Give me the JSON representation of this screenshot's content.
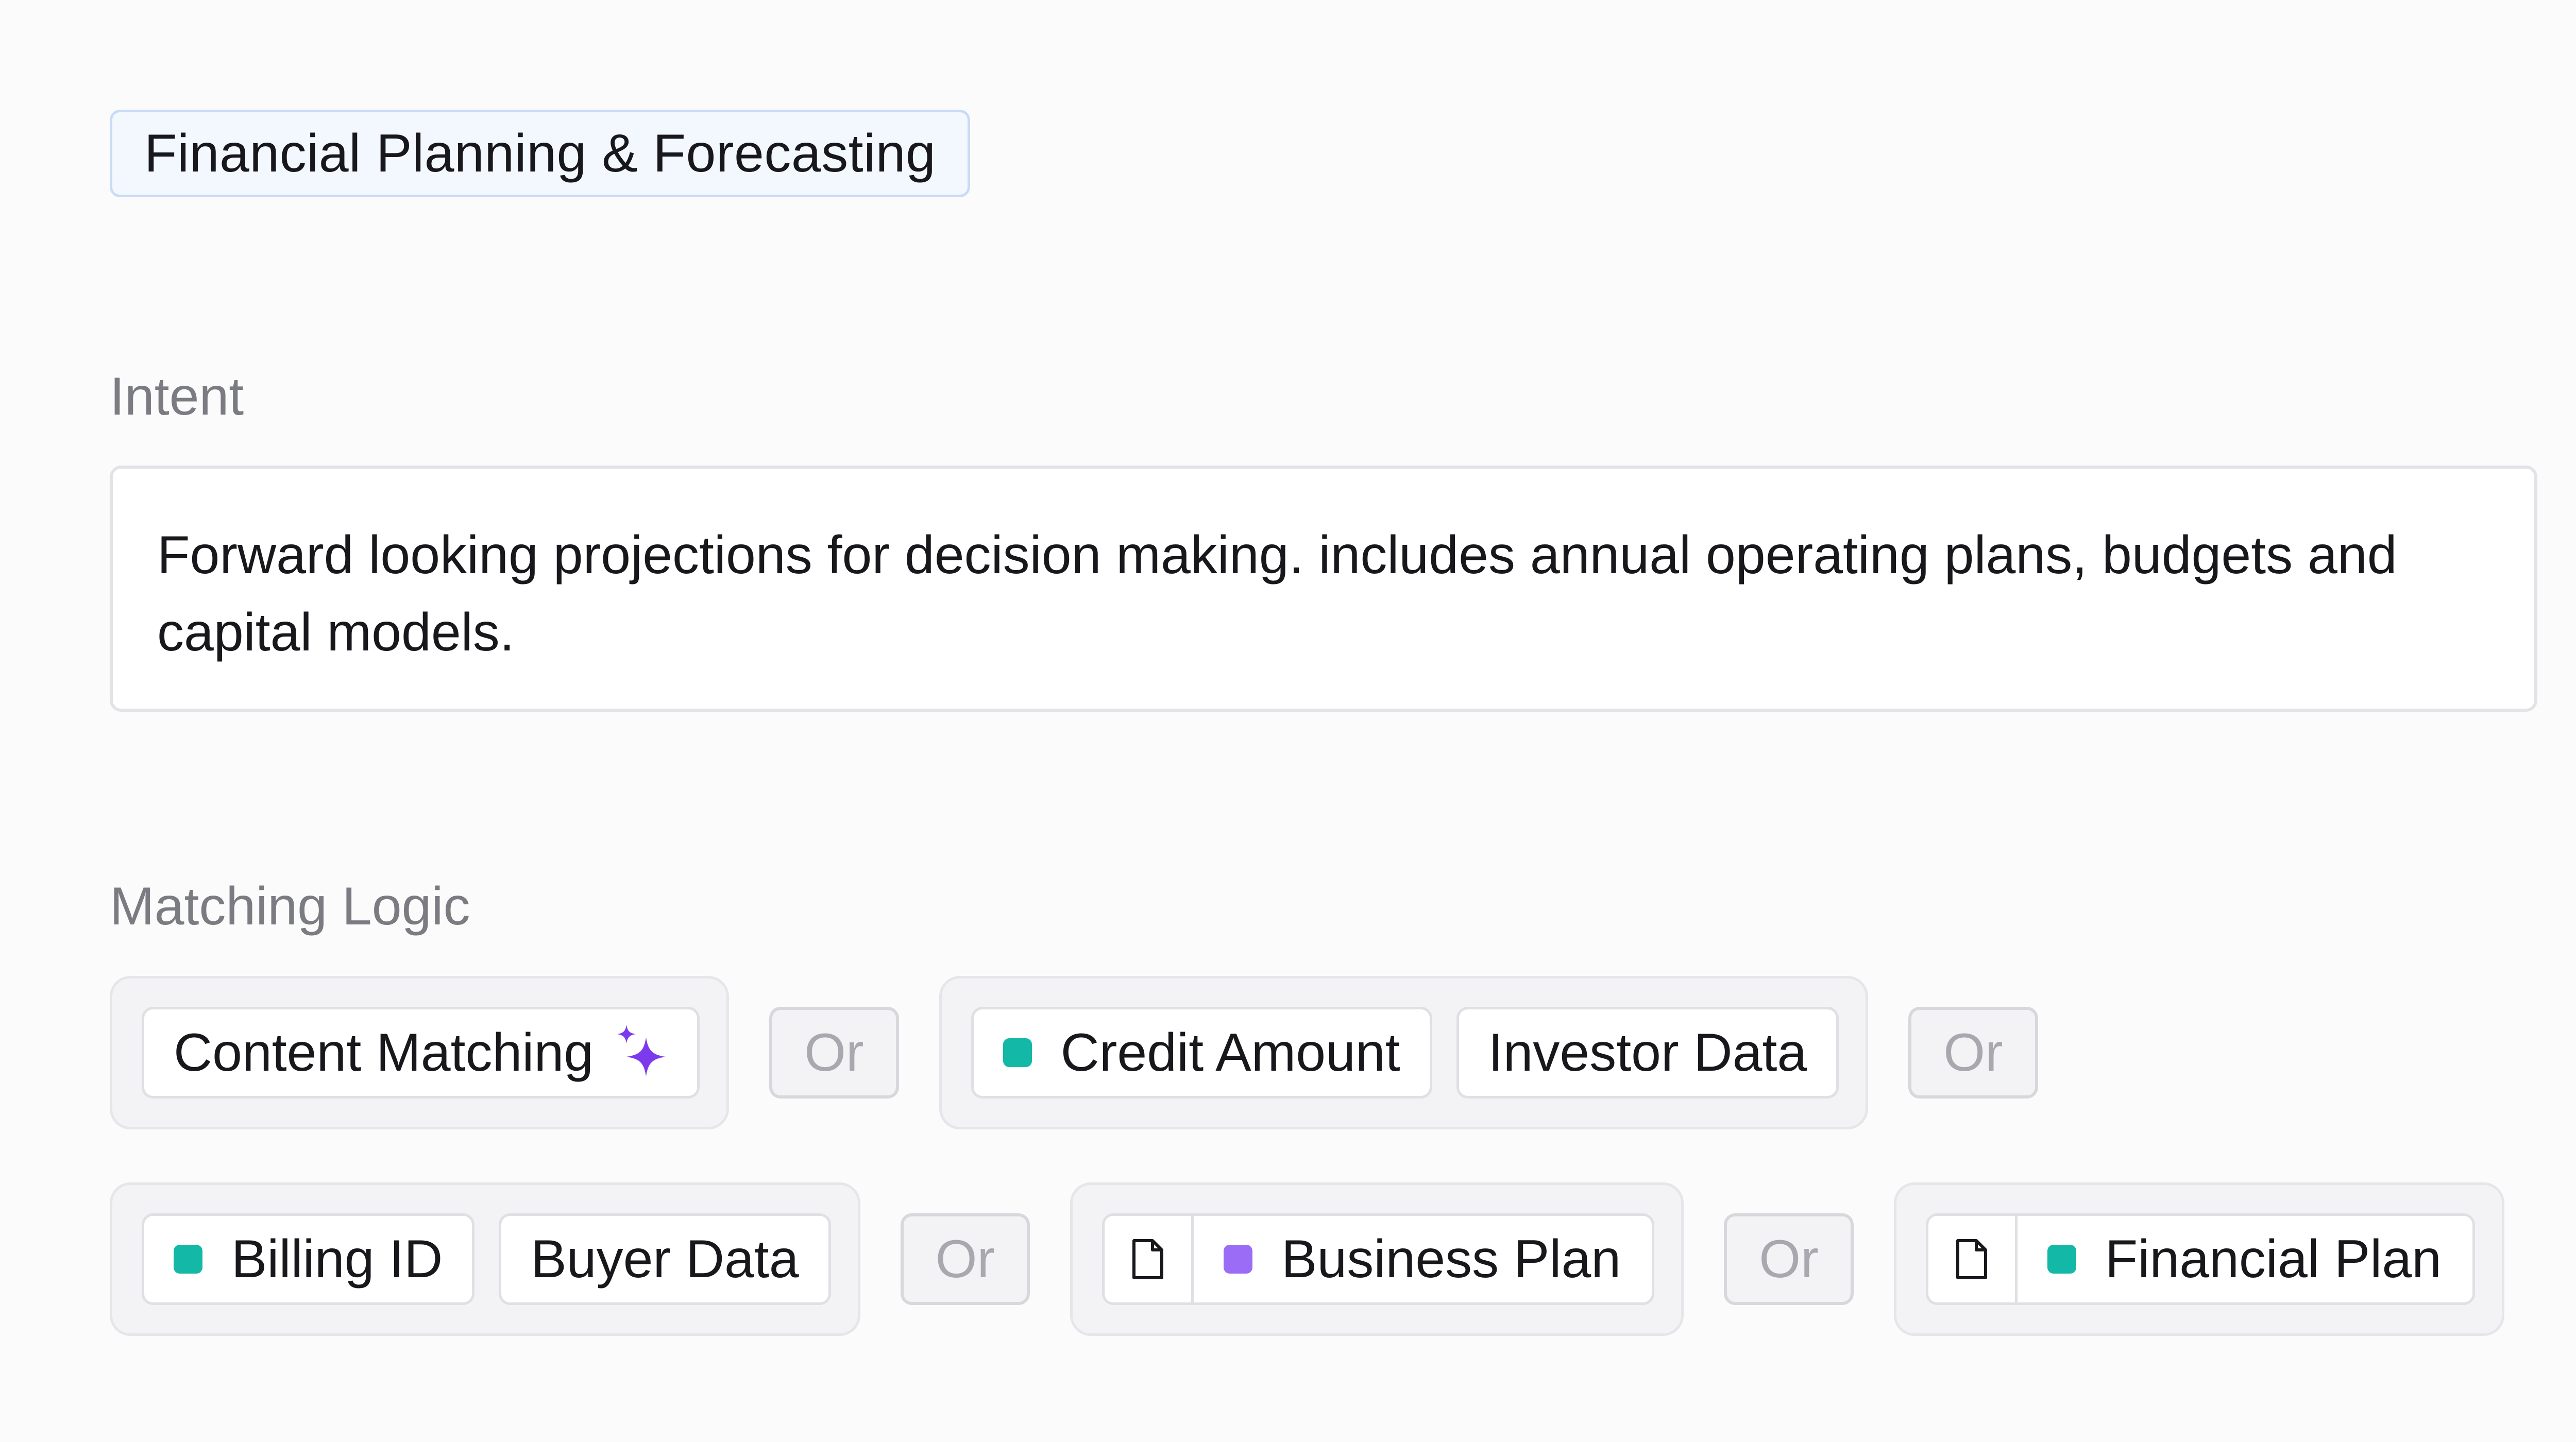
{
  "category": {
    "label": "Financial Planning & Forecasting"
  },
  "intent": {
    "heading": "Intent",
    "text": "Forward looking projections for decision making. includes annual operating plans, budgets and capital models."
  },
  "matching_logic": {
    "heading": "Matching Logic",
    "or_label": "Or",
    "groups": [
      {
        "chips": [
          {
            "label": "Content Matching",
            "icon": "sparkle-icon",
            "icon_color": "#7c3aed"
          }
        ]
      },
      {
        "chips": [
          {
            "label": "Credit Amount",
            "dot_color": "#14b8a6"
          },
          {
            "label": "Investor Data"
          }
        ]
      },
      {
        "chips": [
          {
            "label": "Billing ID",
            "dot_color": "#14b8a6"
          },
          {
            "label": "Buyer Data"
          }
        ]
      },
      {
        "chips": [
          {
            "label": "Business Plan",
            "icon": "document-icon",
            "dot_color": "#9b6cf5"
          }
        ]
      },
      {
        "chips": [
          {
            "label": "Financial Plan",
            "icon": "document-icon",
            "dot_color": "#14b8a6"
          }
        ]
      }
    ]
  }
}
